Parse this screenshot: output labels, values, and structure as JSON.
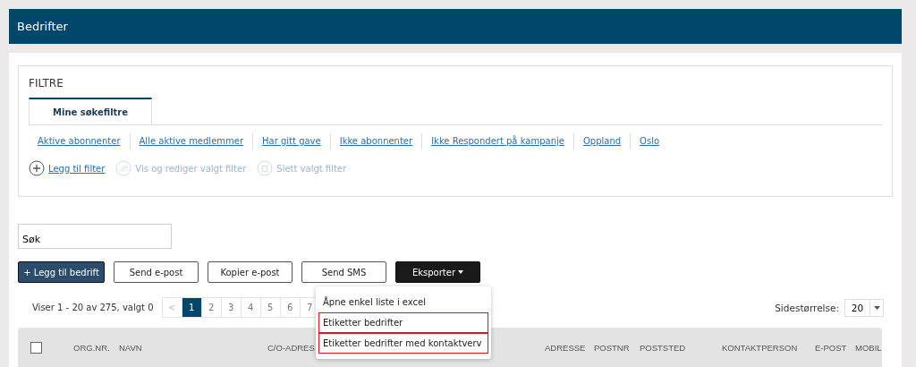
{
  "header": {
    "title": "Bedrifter"
  },
  "filters": {
    "title": "FILTRE",
    "tabs": [
      {
        "label": "Mine søkefiltre",
        "selected": true
      }
    ],
    "saved_filters": [
      "Aktive abonnenter",
      "Alle aktive medlemmer",
      "Har gitt gave",
      "Ikke abonnenter",
      "Ikke Respondert på kampanje",
      "Oppland",
      "Oslo"
    ],
    "actions": [
      {
        "label": "Legg til filter",
        "disabled": false,
        "kind": "add"
      },
      {
        "label": "Vis og rediger valgt filter",
        "disabled": true,
        "kind": "edit"
      },
      {
        "label": "Slett valgt filter",
        "disabled": true,
        "kind": "delete"
      }
    ]
  },
  "search": {
    "value": "Søk"
  },
  "buttons": [
    {
      "label": "+ Legg til bedrift",
      "kind": "primary"
    },
    {
      "label": "Send e-post",
      "kind": "outline"
    },
    {
      "label": "Kopier e-post",
      "kind": "outline"
    },
    {
      "label": "Send SMS",
      "kind": "outline"
    },
    {
      "label": "Eksporter",
      "kind": "dropdown"
    }
  ],
  "export_menu": [
    {
      "label": "Åpne enkel liste i excel",
      "highlighted": false
    },
    {
      "label": "Etiketter bedrifter",
      "highlighted": true
    },
    {
      "label": "Etiketter bedrifter med kontaktverv",
      "highlighted": true
    }
  ],
  "pagination": {
    "summary": "Viser 1 - 20 av 275, valgt 0",
    "prev": "<",
    "pages": [
      {
        "label": "1",
        "selected": true
      },
      {
        "label": "2",
        "selected": false
      },
      {
        "label": "3",
        "selected": false
      },
      {
        "label": "4",
        "selected": false
      },
      {
        "label": "5",
        "selected": false
      },
      {
        "label": "6",
        "selected": false
      },
      {
        "label": "7",
        "selected": false
      }
    ]
  },
  "page_size": {
    "label": "Sidestørrelse:",
    "value": "20"
  },
  "table": {
    "select_all": {
      "checked": false
    },
    "columns": [
      "ORG.NR.",
      "NAVN",
      "C/O-ADRES",
      "ADRESSE",
      "POSTNR",
      "POSTSTED",
      "KONTAKTPERSON",
      "E-POST",
      "MOBIL"
    ]
  }
}
